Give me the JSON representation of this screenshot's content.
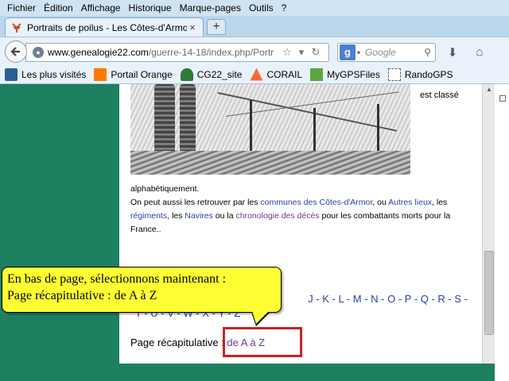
{
  "menu": {
    "items": [
      "Fichier",
      "Édition",
      "Affichage",
      "Historique",
      "Marque-pages",
      "Outils",
      "?"
    ]
  },
  "tab": {
    "title": "Portraits de poilus - Les Côtes-d'Armor ...",
    "close": "×",
    "new_tab": "+"
  },
  "nav": {
    "url_domain": "www.genealogie22.com",
    "url_path": "/guerre-14-18/index.php/Portr",
    "search_engine": "Google",
    "search_placeholder": "Google"
  },
  "bookmarks": [
    {
      "label": "Les plus visités",
      "icon": "bookmark-book-icon"
    },
    {
      "label": "Portail Orange",
      "icon": "orange-logo-icon"
    },
    {
      "label": "CG22_site",
      "icon": "cg22-logo-icon"
    },
    {
      "label": "CORAIL",
      "icon": "corail-logo-icon"
    },
    {
      "label": "MyGPSFiles",
      "icon": "mygps-logo-icon"
    },
    {
      "label": "RandoGPS",
      "icon": "page-icon"
    }
  ],
  "page": {
    "est_classe": "est classé",
    "para1": "alphabétiquement.",
    "para2_before": "On peut aussi les retrouver par les ",
    "link_communes": "communes des Côtes-d'Armor",
    "para2_mid1": ", ou ",
    "link_autres": "Autres lieux",
    "para2_mid2": ", les ",
    "link_regiments": "régiments",
    "para2_mid3": ", les ",
    "link_navires": "Navires",
    "para2_mid4": " ou la ",
    "link_chrono": "chronologie des décès",
    "para2_after": " pour les combattants morts pour la France..",
    "letters_line1": "J - K - L - M - N - O - P - Q - R - S -",
    "letters_line2": "T - U - V - W - X - Y - Z",
    "recap_label": "Page récapitulative : ",
    "recap_link": "de A à Z"
  },
  "callout": {
    "line1": "En bas de page, sélectionnons maintenant :",
    "line2": "Page récapitulative : de A à Z"
  },
  "colors": {
    "highlight_box": "#d21f1f",
    "callout_bg": "#ffff33",
    "page_side": "#1d8060"
  }
}
